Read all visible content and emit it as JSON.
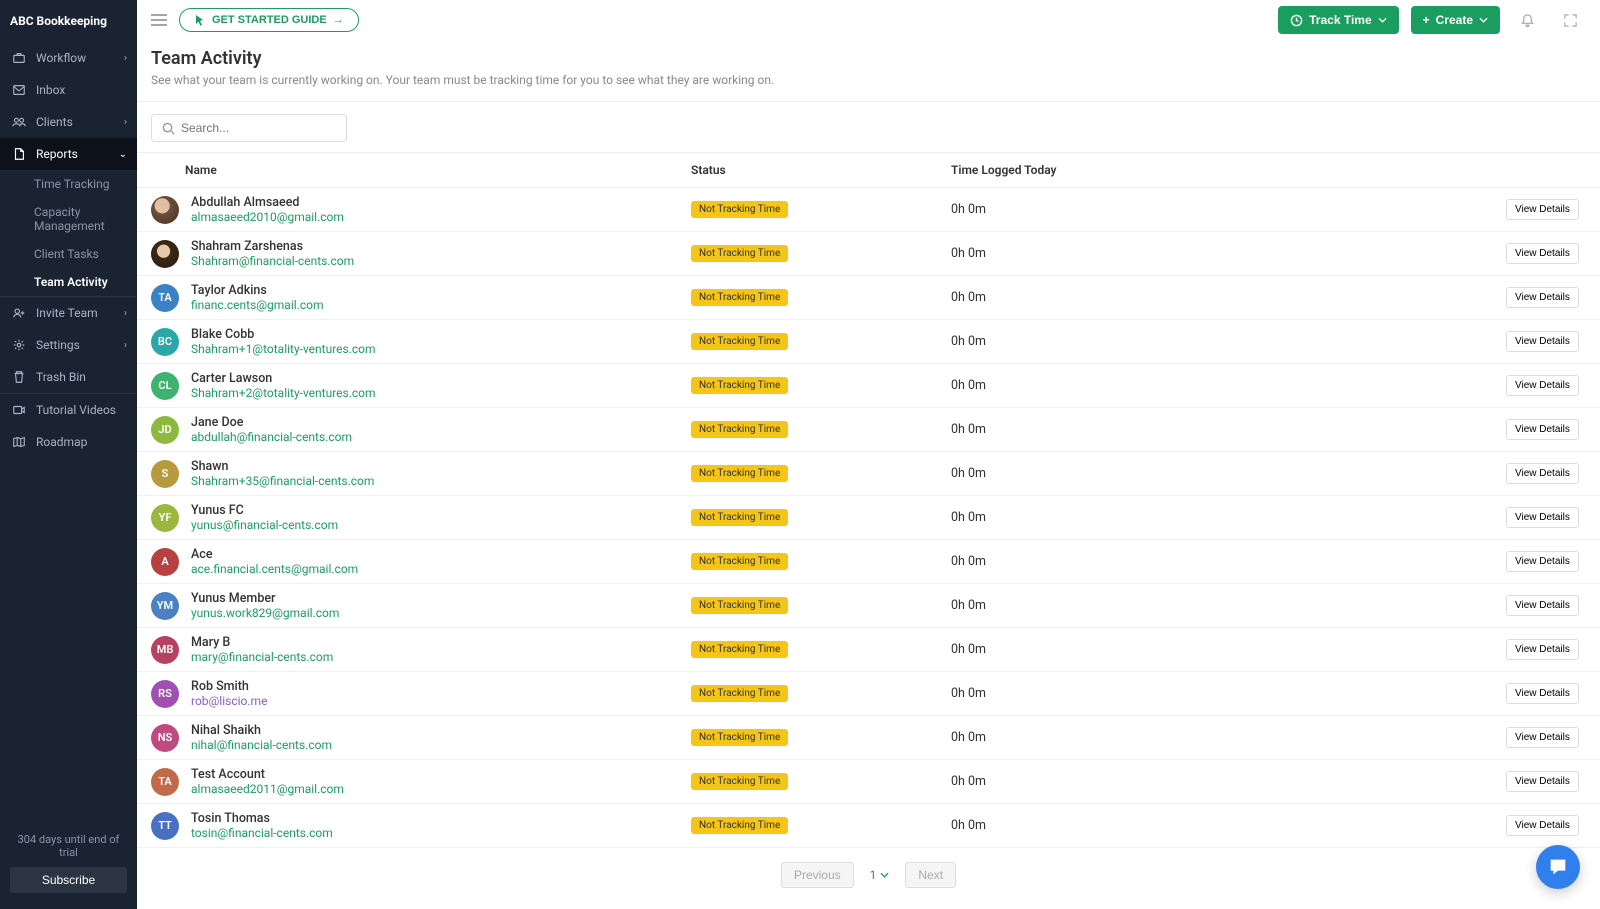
{
  "brand": "ABC Bookkeeping",
  "sidebar": {
    "items": [
      {
        "label": "Workflow",
        "icon": "briefcase",
        "expandable": true
      },
      {
        "label": "Inbox",
        "icon": "mail",
        "expandable": false
      },
      {
        "label": "Clients",
        "icon": "users",
        "expandable": true
      },
      {
        "label": "Reports",
        "icon": "file",
        "expandable": true,
        "active": true,
        "children": [
          {
            "label": "Time Tracking"
          },
          {
            "label": "Capacity Management"
          },
          {
            "label": "Client Tasks"
          },
          {
            "label": "Team Activity",
            "active": true
          }
        ]
      }
    ],
    "secondary": [
      {
        "label": "Invite Team",
        "icon": "user-plus",
        "expandable": true
      },
      {
        "label": "Settings",
        "icon": "gear",
        "expandable": true
      },
      {
        "label": "Trash Bin",
        "icon": "trash",
        "expandable": false
      }
    ],
    "tertiary": [
      {
        "label": "Tutorial Videos",
        "icon": "video"
      },
      {
        "label": "Roadmap",
        "icon": "map"
      }
    ],
    "trial": {
      "text": "304 days until end of trial",
      "button": "Subscribe"
    }
  },
  "topbar": {
    "getStarted": "GET STARTED GUIDE",
    "trackTime": "Track Time",
    "create": "Create"
  },
  "page": {
    "title": "Team Activity",
    "subtitle": "See what your team is currently working on. Your team must be tracking time for you to see what they are working on."
  },
  "search": {
    "placeholder": "Search..."
  },
  "columns": {
    "name": "Name",
    "status": "Status",
    "time": "Time Logged Today"
  },
  "statusLabel": "Not Tracking Time",
  "viewLabel": "View Details",
  "rows": [
    {
      "name": "Abdullah Almsaeed",
      "email": "almasaeed2010@gmail.com",
      "time": "0h 0m",
      "avatarType": "img1"
    },
    {
      "name": "Shahram Zarshenas",
      "email": "Shahram@financial-cents.com",
      "time": "0h 0m",
      "avatarType": "img2"
    },
    {
      "name": "Taylor Adkins",
      "email": "financ.cents@gmail.com",
      "time": "0h 0m",
      "initials": "TA",
      "color": "#3b82c4"
    },
    {
      "name": "Blake Cobb",
      "email": "Shahram+1@totality-ventures.com",
      "time": "0h 0m",
      "initials": "BC",
      "color": "#2aa8a8"
    },
    {
      "name": "Carter Lawson",
      "email": "Shahram+2@totality-ventures.com",
      "time": "0h 0m",
      "initials": "CL",
      "color": "#3eb370"
    },
    {
      "name": "Jane Doe",
      "email": "abdullah@financial-cents.com",
      "time": "0h 0m",
      "initials": "JD",
      "color": "#8fb83e"
    },
    {
      "name": "Shawn",
      "email": "Shahram+35@financial-cents.com",
      "time": "0h 0m",
      "initials": "S",
      "color": "#b89a3e"
    },
    {
      "name": "Yunus FC",
      "email": "yunus@financial-cents.com",
      "time": "0h 0m",
      "initials": "YF",
      "color": "#9ab83e"
    },
    {
      "name": "Ace",
      "email": "ace.financial.cents@gmail.com",
      "time": "0h 0m",
      "initials": "A",
      "color": "#b84040"
    },
    {
      "name": "Yunus Member",
      "email": "yunus.work829@gmail.com",
      "time": "0h 0m",
      "initials": "YM",
      "color": "#4a80c4"
    },
    {
      "name": "Mary B",
      "email": "mary@financial-cents.com",
      "time": "0h 0m",
      "initials": "MB",
      "color": "#b84060"
    },
    {
      "name": "Rob Smith",
      "email": "rob@liscio.me",
      "time": "0h 0m",
      "initials": "RS",
      "color": "#a050b0",
      "emailColor": "purple"
    },
    {
      "name": "Nihal Shaikh",
      "email": "nihal@financial-cents.com",
      "time": "0h 0m",
      "initials": "NS",
      "color": "#c04a80"
    },
    {
      "name": "Test Account",
      "email": "almasaeed2011@gmail.com",
      "time": "0h 0m",
      "initials": "TA",
      "color": "#c06a4a"
    },
    {
      "name": "Tosin Thomas",
      "email": "tosin@financial-cents.com",
      "time": "0h 0m",
      "initials": "TT",
      "color": "#4a70c4"
    }
  ],
  "pagination": {
    "prev": "Previous",
    "page": "1",
    "next": "Next"
  }
}
